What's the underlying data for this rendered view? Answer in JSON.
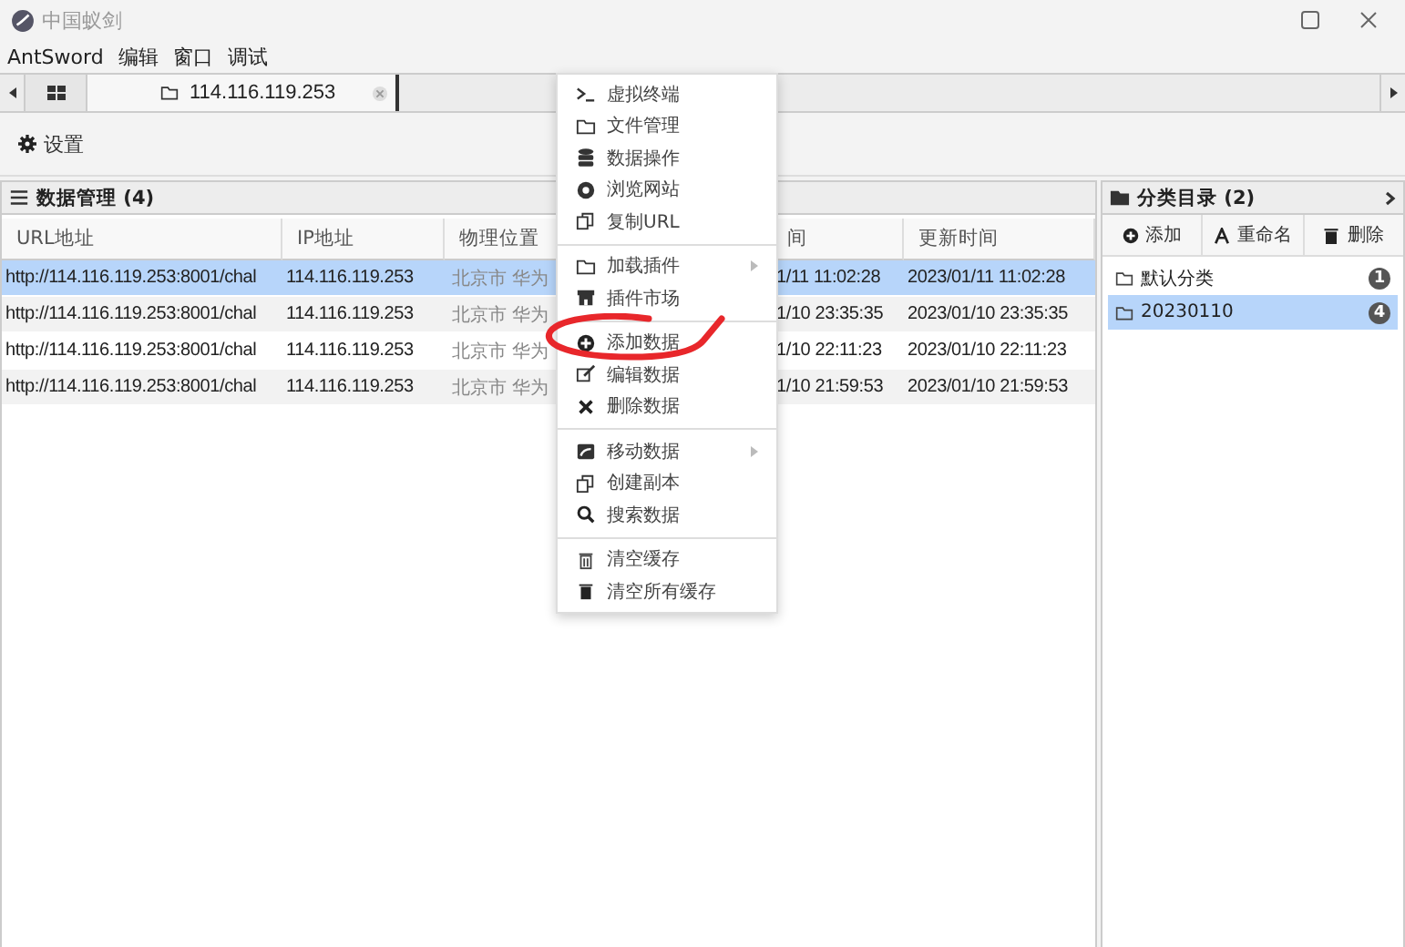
{
  "window": {
    "title": "中国蚁剑"
  },
  "menu_bar": [
    "AntSword",
    "编辑",
    "窗口",
    "调试"
  ],
  "tabs": [
    {
      "kind": "home",
      "selected": false
    },
    {
      "kind": "host",
      "label": "114.116.119.253",
      "selected": true
    }
  ],
  "toolbar": [
    {
      "label": "设置"
    }
  ],
  "data_panel": {
    "title": "数据管理 (4)",
    "columns": [
      "URL地址",
      "IP地址",
      "物理位置",
      "间",
      "更新时间"
    ],
    "rows": [
      {
        "cells": [
          "http://114.116.119.253:8001/chal",
          "114.116.119.253",
          "北京市 华为",
          "1/11 11:02:28",
          "2023/01/11 11:02:28"
        ],
        "selected": true
      },
      {
        "cells": [
          "http://114.116.119.253:8001/chal",
          "114.116.119.253",
          "北京市 华为",
          "1/10 23:35:35",
          "2023/01/10 23:35:35"
        ],
        "selected": false
      },
      {
        "cells": [
          "http://114.116.119.253:8001/chal",
          "114.116.119.253",
          "北京市 华为",
          "1/10 22:11:23",
          "2023/01/10 22:11:23"
        ],
        "selected": false
      },
      {
        "cells": [
          "http://114.116.119.253:8001/chal",
          "114.116.119.253",
          "北京市 华为",
          "1/10 21:59:53",
          "2023/01/10 21:59:53"
        ],
        "selected": false
      }
    ]
  },
  "context_menu": {
    "groups": [
      [
        {
          "label": "虚拟终端",
          "submenu": false
        },
        {
          "label": "文件管理",
          "submenu": false
        },
        {
          "label": "数据操作",
          "submenu": false
        },
        {
          "label": "浏览网站",
          "submenu": false
        },
        {
          "label": "复制URL",
          "submenu": false
        }
      ],
      [
        {
          "label": "加载插件",
          "submenu": true
        },
        {
          "label": "插件市场",
          "submenu": false
        }
      ],
      [
        {
          "label": "添加数据",
          "submenu": false
        },
        {
          "label": "编辑数据",
          "submenu": false
        },
        {
          "label": "删除数据",
          "submenu": false
        }
      ],
      [
        {
          "label": "移动数据",
          "submenu": true
        },
        {
          "label": "创建副本",
          "submenu": false
        },
        {
          "label": "搜索数据",
          "submenu": false
        }
      ],
      [
        {
          "label": "清空缓存",
          "submenu": false
        },
        {
          "label": "清空所有缓存",
          "submenu": false
        }
      ]
    ]
  },
  "category_panel": {
    "title": "分类目录 (2)",
    "buttons": [
      "添加",
      "重命名",
      "删除"
    ],
    "items": [
      {
        "label": "默认分类",
        "count": "1",
        "selected": false
      },
      {
        "label": "20230110",
        "count": "4",
        "selected": true
      }
    ]
  }
}
